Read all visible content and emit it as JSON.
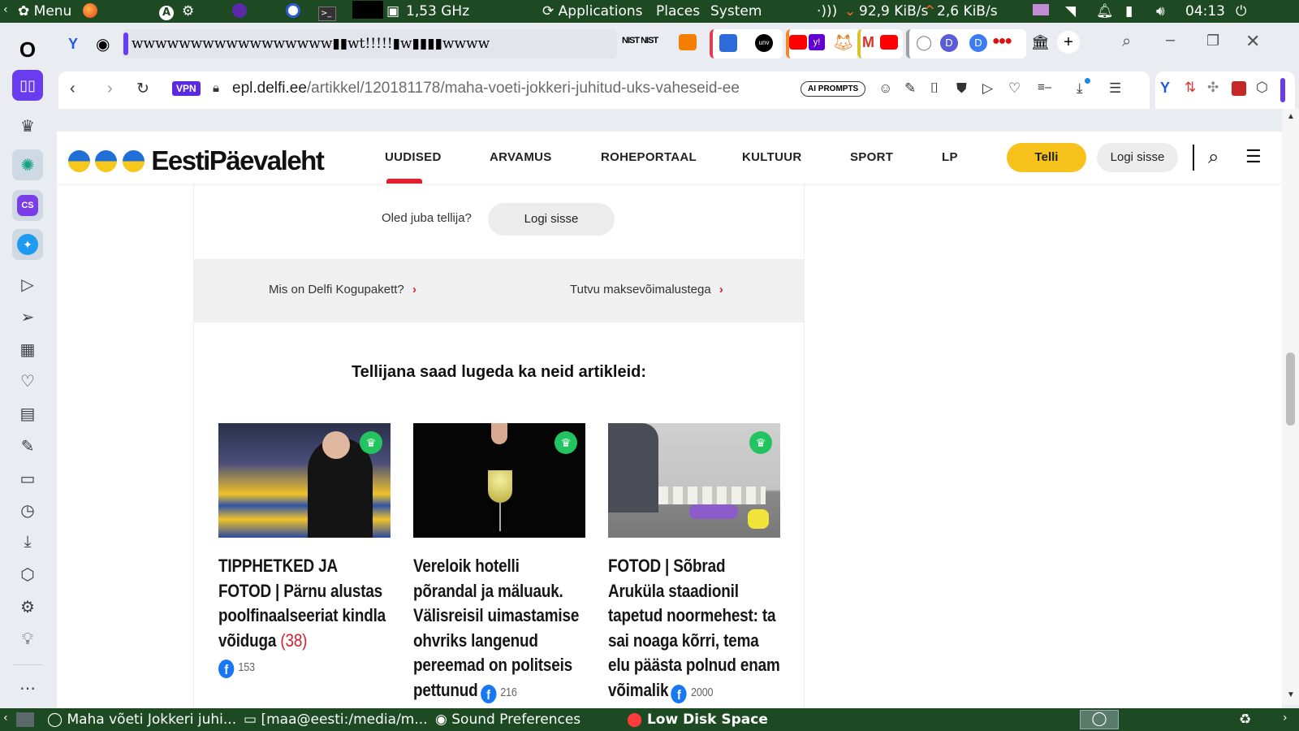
{
  "os_panel": {
    "menu_label": "Menu",
    "cpu_freq": "1,53 GHz",
    "applications": "Applications",
    "places": "Places",
    "system": "System",
    "net_down": "92,9 KiB/s",
    "net_up": "2,6 KiB/s",
    "clock": "04:13"
  },
  "browser": {
    "address_bar": {
      "vpn_badge": "VPN",
      "url_domain": "epl.delfi.ee",
      "url_path": "/artikkel/120181178/maha-voeti-jokkeri-juhitud-uks-vaheseid-ee",
      "ai_prompts": "AI PROMPTS"
    },
    "tab_strip_text": "wwwwwwwwwwwwwwwww▮▮wt!!!!!▮w▮▮▮▮wwww"
  },
  "site": {
    "logo_text": "EestiPäevaleht",
    "nav": [
      "UUDISED",
      "ARVAMUS",
      "ROHEPORTAAL",
      "KULTUUR",
      "SPORT",
      "LP"
    ],
    "subscribe_button": "Telli",
    "login_button": "Logi sisse"
  },
  "article": {
    "already_subscriber": "Oled juba tellija?",
    "login_button": "Logi sisse",
    "link_package": "Mis on Delfi Kogupakett?",
    "link_payments": "Tutvu maksevõimalustega",
    "section_heading": "Tellijana saad lugeda ka neid artikleid:",
    "cards": [
      {
        "title": "TIPPHETKED JA FOTOD | Pärnu alustas poolfinaalseeriat kindla võiduga",
        "comments": "(38)",
        "fb_count": "153"
      },
      {
        "title": "Vereloik hotelli põrandal ja mäluauk. Välisreisil uimastamise ohvriks langenud pereemad on politseis pettunud",
        "comments": "",
        "fb_count": "216"
      },
      {
        "title": "FOTOD | Sõbrad Aruküla staadionil tapetud noormehest: ta sai noaga kõrri, tema elu päästa polnud enam võimalik",
        "comments": "",
        "fb_count": "2000"
      }
    ]
  },
  "taskbar": {
    "win1": "Maha võeti Jokkeri juhi...",
    "win2": "[maa@eesti:/media/m...",
    "win3": "Sound Preferences",
    "win4": "Low Disk Space"
  },
  "colors": {
    "os_panel": "#1d4a22",
    "telli": "#f7c21b",
    "nav_active": "#e0202f",
    "crown": "#23c460",
    "comment_red": "#d4202f",
    "opera_accent": "#6a3cf0"
  }
}
